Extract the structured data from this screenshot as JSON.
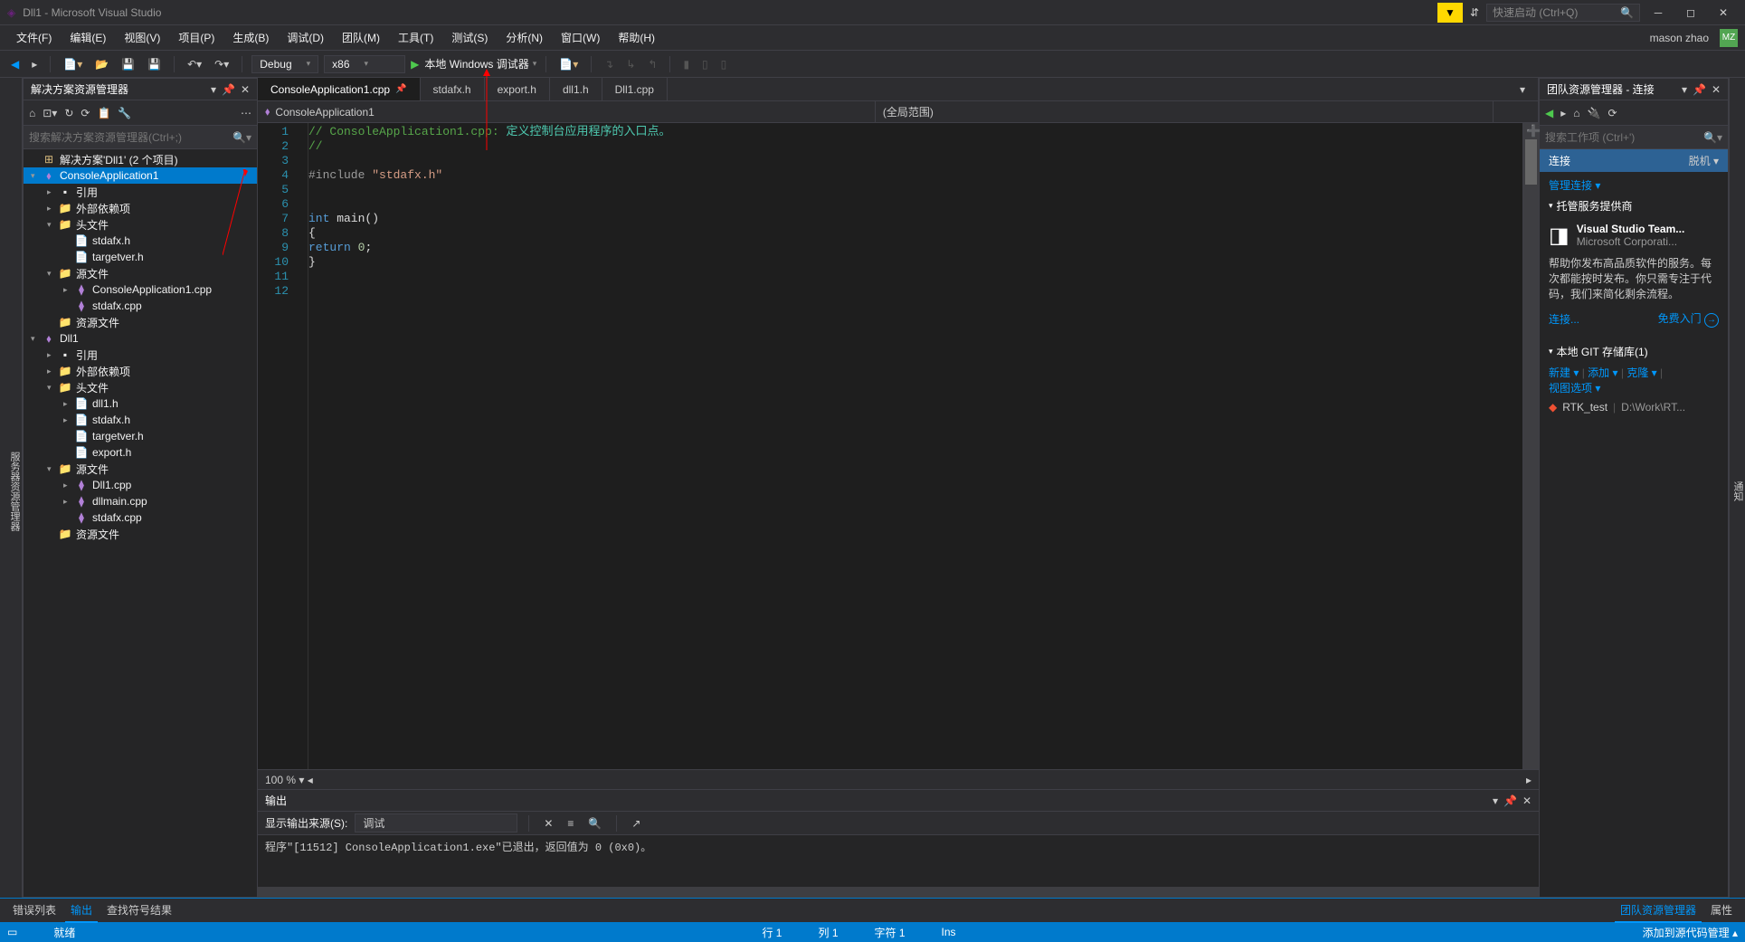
{
  "titlebar": {
    "title": "Dll1 - Microsoft Visual Studio",
    "quick_launch_placeholder": "快速启动 (Ctrl+Q)"
  },
  "menubar": {
    "items": [
      "文件(F)",
      "编辑(E)",
      "视图(V)",
      "项目(P)",
      "生成(B)",
      "调试(D)",
      "团队(M)",
      "工具(T)",
      "测试(S)",
      "分析(N)",
      "窗口(W)",
      "帮助(H)"
    ],
    "username": "mason zhao",
    "userbadge": "MZ"
  },
  "toolbar": {
    "config": "Debug",
    "platform": "x86",
    "debugger": "本地 Windows 调试器"
  },
  "left_gutter": "服务器资源管理器",
  "right_gutter": "通知",
  "solution_explorer": {
    "title": "解决方案资源管理器",
    "search_placeholder": "搜索解决方案资源管理器(Ctrl+;)",
    "tree": [
      {
        "depth": 0,
        "expand": "",
        "icon": "sol",
        "label": "解决方案'Dll1' (2 个项目)"
      },
      {
        "depth": 0,
        "expand": "▾",
        "icon": "purple",
        "label": "ConsoleApplication1",
        "selected": true
      },
      {
        "depth": 1,
        "expand": "▸",
        "icon": "ref",
        "label": "引用"
      },
      {
        "depth": 1,
        "expand": "▸",
        "icon": "folder",
        "label": "外部依赖项"
      },
      {
        "depth": 1,
        "expand": "▾",
        "icon": "folder",
        "label": "头文件"
      },
      {
        "depth": 2,
        "expand": "",
        "icon": "h",
        "label": "stdafx.h"
      },
      {
        "depth": 2,
        "expand": "",
        "icon": "h",
        "label": "targetver.h"
      },
      {
        "depth": 1,
        "expand": "▾",
        "icon": "folder",
        "label": "源文件"
      },
      {
        "depth": 2,
        "expand": "▸",
        "icon": "cpp",
        "label": "ConsoleApplication1.cpp"
      },
      {
        "depth": 2,
        "expand": "",
        "icon": "cpp",
        "label": "stdafx.cpp"
      },
      {
        "depth": 1,
        "expand": "",
        "icon": "folder",
        "label": "资源文件"
      },
      {
        "depth": 0,
        "expand": "▾",
        "icon": "purple",
        "label": "Dll1"
      },
      {
        "depth": 1,
        "expand": "▸",
        "icon": "ref",
        "label": "引用"
      },
      {
        "depth": 1,
        "expand": "▸",
        "icon": "folder",
        "label": "外部依赖项"
      },
      {
        "depth": 1,
        "expand": "▾",
        "icon": "folder",
        "label": "头文件"
      },
      {
        "depth": 2,
        "expand": "▸",
        "icon": "h",
        "label": "dll1.h"
      },
      {
        "depth": 2,
        "expand": "▸",
        "icon": "h",
        "label": "stdafx.h"
      },
      {
        "depth": 2,
        "expand": "",
        "icon": "h",
        "label": "targetver.h"
      },
      {
        "depth": 2,
        "expand": "",
        "icon": "h",
        "label": "export.h"
      },
      {
        "depth": 1,
        "expand": "▾",
        "icon": "folder",
        "label": "源文件"
      },
      {
        "depth": 2,
        "expand": "▸",
        "icon": "cpp",
        "label": "Dll1.cpp"
      },
      {
        "depth": 2,
        "expand": "▸",
        "icon": "cpp",
        "label": "dllmain.cpp"
      },
      {
        "depth": 2,
        "expand": "",
        "icon": "cpp",
        "label": "stdafx.cpp"
      },
      {
        "depth": 1,
        "expand": "",
        "icon": "folder",
        "label": "资源文件"
      }
    ]
  },
  "tabs": [
    {
      "label": "ConsoleApplication1.cpp",
      "active": true,
      "pinned": true
    },
    {
      "label": "stdafx.h",
      "active": false
    },
    {
      "label": "export.h",
      "active": false
    },
    {
      "label": "dll1.h",
      "active": false
    },
    {
      "label": "Dll1.cpp",
      "active": false
    }
  ],
  "nav": {
    "left": "ConsoleApplication1",
    "right": "(全局范围)"
  },
  "code_lines": [
    {
      "n": 1,
      "html": "<span class='comment'>// ConsoleApplication1.cpp: </span><span style='color:#4ec9b0'>定义控制台应用程序的入口点。</span>"
    },
    {
      "n": 2,
      "html": "<span class='comment'>//</span>"
    },
    {
      "n": 3,
      "html": ""
    },
    {
      "n": 4,
      "html": "<span class='pre'>#include </span><span class='str'>\"stdafx.h\"</span>"
    },
    {
      "n": 5,
      "html": ""
    },
    {
      "n": 6,
      "html": ""
    },
    {
      "n": 7,
      "html": "<span class='keyword'>int</span> main()"
    },
    {
      "n": 8,
      "html": "{"
    },
    {
      "n": 9,
      "html": "    <span class='keyword'>return</span> <span class='num'>0</span>;"
    },
    {
      "n": 10,
      "html": "}"
    },
    {
      "n": 11,
      "html": ""
    },
    {
      "n": 12,
      "html": ""
    }
  ],
  "zoom": "100 %",
  "output": {
    "title": "输出",
    "source_label": "显示输出来源(S):",
    "source_value": "调试",
    "text": "程序\"[11512] ConsoleApplication1.exe\"已退出，返回值为 0 (0x0)。"
  },
  "bottom_tabs": {
    "left": [
      "错误列表",
      "输出",
      "查找符号结果"
    ],
    "left_active": 1,
    "right": [
      "团队资源管理器",
      "属性"
    ],
    "right_active": 0
  },
  "team_panel": {
    "title": "团队资源管理器 - 连接",
    "search_placeholder": "搜索工作项 (Ctrl+')",
    "conn_header": "连接",
    "offline": "脱机",
    "manage_link": "管理连接 ▾",
    "hosted_header": "托管服务提供商",
    "vsts_title": "Visual Studio Team...",
    "vsts_sub": "Microsoft Corporati...",
    "desc": "帮助你发布高品质软件的服务。每次都能按时发布。你只需专注于代码，我们来简化剩余流程。",
    "connect_link": "连接...",
    "free_link": "免费入门",
    "git_header": "本地 GIT 存储库(1)",
    "git_links": [
      "新建 ▾",
      "添加 ▾",
      "克隆 ▾"
    ],
    "git_view": "视图选项 ▾",
    "repo_name": "RTK_test",
    "repo_path": "D:\\Work\\RT..."
  },
  "statusbar": {
    "ready": "就绪",
    "line": "行 1",
    "col": "列 1",
    "char": "字符 1",
    "ins": "Ins",
    "scm": "添加到源代码管理 ▴"
  }
}
